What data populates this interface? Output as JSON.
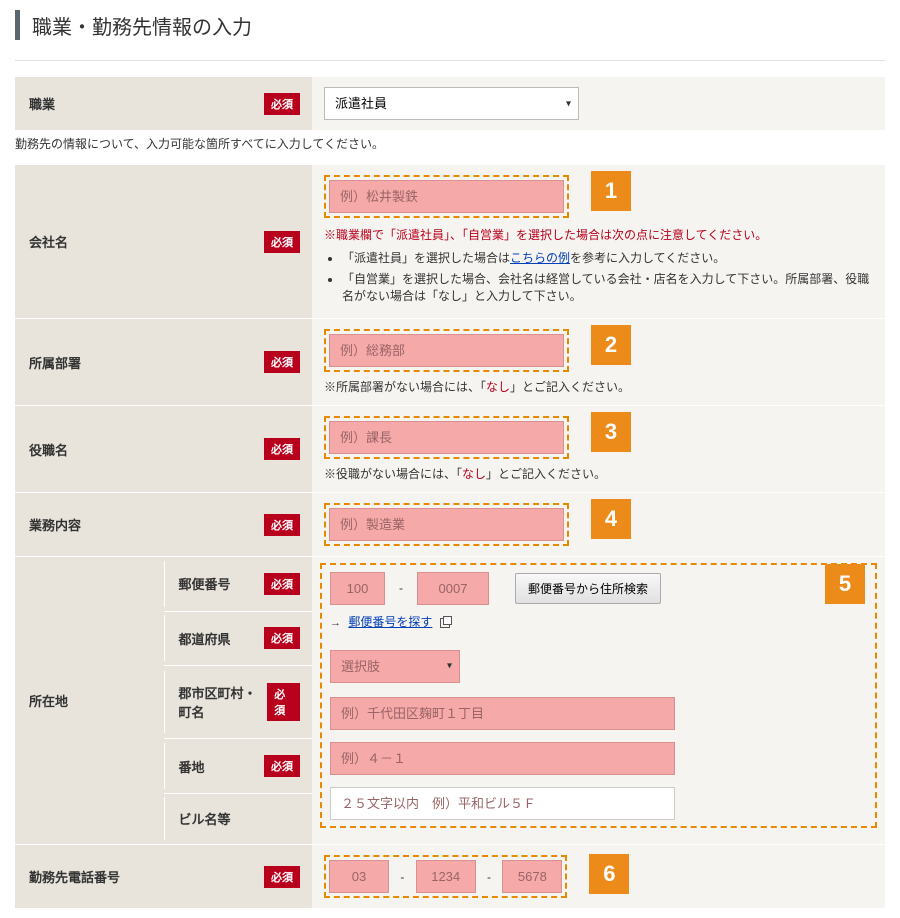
{
  "page": {
    "title": "職業・勤務先情報の入力"
  },
  "required_label": "必須",
  "instruction": "勤務先の情報について、入力可能な箇所すべてに入力してください。",
  "badges": {
    "n1": "1",
    "n2": "2",
    "n3": "3",
    "n4": "4",
    "n5": "5",
    "n6": "6"
  },
  "occupation": {
    "label": "職業",
    "selected": "派遣社員"
  },
  "company_name": {
    "label": "会社名",
    "placeholder": "例）松井製鉄",
    "warn": "※職業欄で「派遣社員」、「自営業」を選択した場合は次の点に注意してください。",
    "bullet1_pre": "「派遣社員」を選択した場合は",
    "bullet1_link": "こちらの例",
    "bullet1_post": "を参考に入力してください。",
    "bullet2": "「自営業」を選択した場合、会社名は経営している会社・店名を入力して下さい。所属部署、役職名がない場合は「なし」と入力して下さい。"
  },
  "department": {
    "label": "所属部署",
    "placeholder": "例）総務部",
    "note_pre": "※所属部署がない場合には、「",
    "note_red": "なし",
    "note_post": "」とご記入ください。"
  },
  "position": {
    "label": "役職名",
    "placeholder": "例）課長",
    "note_pre": "※役職がない場合には、「",
    "note_red": "なし",
    "note_post": "」とご記入ください。"
  },
  "job_content": {
    "label": "業務内容",
    "placeholder": "例）製造業"
  },
  "address": {
    "group_label": "所在地",
    "postal": {
      "label": "郵便番号",
      "ph1": "100",
      "ph2": "0007",
      "search_btn": "郵便番号から住所検索",
      "find_link": "郵便番号を探す"
    },
    "pref": {
      "label": "都道府県",
      "selected": "選択肢"
    },
    "city": {
      "label": "郡市区町村・町名",
      "placeholder": "例）千代田区麹町１丁目"
    },
    "banchi": {
      "label": "番地",
      "placeholder": "例）４－１"
    },
    "building": {
      "label": "ビル名等",
      "placeholder": "２５文字以内　例）平和ビル５Ｆ"
    }
  },
  "phone": {
    "label": "勤務先電話番号",
    "ph1": "03",
    "ph2": "1234",
    "ph3": "5678"
  }
}
